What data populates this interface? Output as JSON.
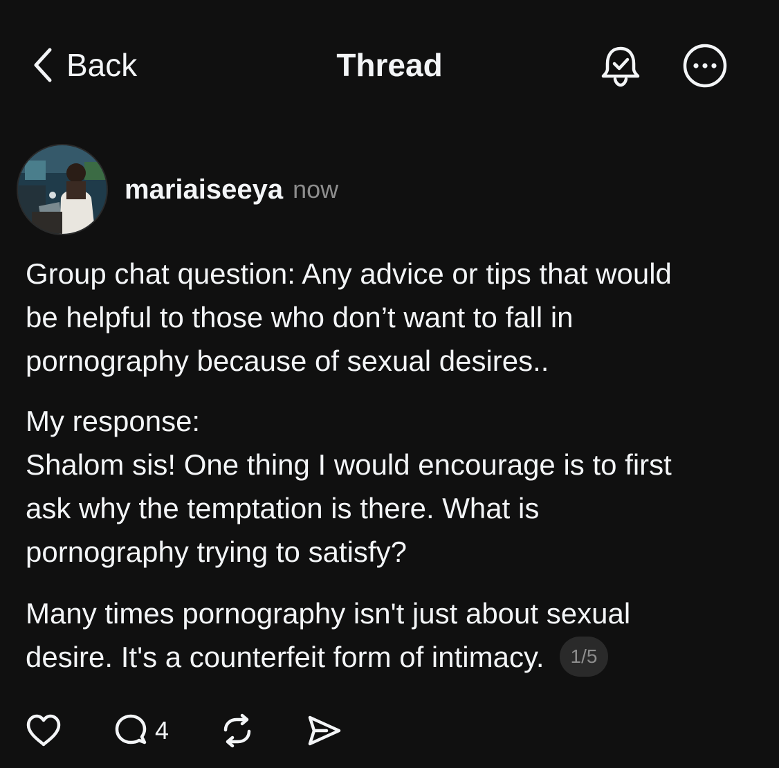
{
  "header": {
    "back_label": "Back",
    "title": "Thread"
  },
  "post": {
    "author": "mariaiseeya",
    "time": "now",
    "paragraphs": [
      [
        "Group chat question: Any advice or tips that would",
        "be helpful to those who don’t want to fall in",
        "pornography because of sexual desires.."
      ],
      [
        "My response:",
        "Shalom sis! One thing I would encourage is to first",
        "ask why the temptation is there. What is",
        "pornography trying to satisfy?"
      ],
      [
        "Many times pornography isn't just about sexual",
        "desire. It's a counterfeit form of intimacy."
      ]
    ],
    "thread_counter": "1/5",
    "reply_count": "4"
  },
  "icons": {
    "back": "chevron-left-icon",
    "notify": "bell-check-icon",
    "more": "more-circle-icon",
    "like": "heart-icon",
    "reply": "comment-icon",
    "repost": "repost-icon",
    "share": "send-icon"
  },
  "colors": {
    "background": "#101010",
    "text": "#f3f5f7",
    "secondary": "#8d8d8d",
    "pill": "#2a2a2a"
  }
}
